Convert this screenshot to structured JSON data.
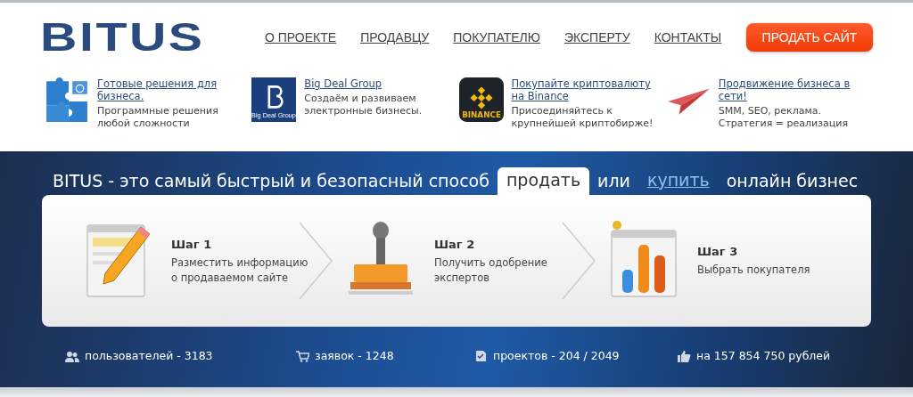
{
  "header": {
    "logo": "BITUS",
    "nav": [
      "О ПРОЕКТЕ",
      "ПРОДАВЦУ",
      "ПОКУПАТЕЛЮ",
      "ЭКСПЕРТУ",
      "КОНТАКТЫ"
    ],
    "cta": "ПРОДАТЬ САЙТ"
  },
  "promos": [
    {
      "kind": "puzzle",
      "title": "Готовые решения для бизнеса.",
      "text": "Программные решения любой сложности"
    },
    {
      "kind": "bigdeal",
      "logo_text": "Big Deal Group",
      "title": "Big Deal Group",
      "text": "Создаём и развиваем электронные бизнесы."
    },
    {
      "kind": "binance",
      "logo_text": "BINANCE",
      "title": "Покупайте криптовалюту на Binance",
      "text": "Присоединяйтесь к крупнейшей криптобирже!"
    },
    {
      "kind": "plane",
      "title": "Продвижение бизнеса в сети!",
      "text": "SMM, SEO, реклама. Стратегия = реализация"
    }
  ],
  "headline": {
    "prefix": "BITUS - это самый быстрый и безопасный способ",
    "options": [
      {
        "label": "продать",
        "selected": true
      },
      {
        "label": "купить",
        "selected": false
      }
    ],
    "separator": "или",
    "suffix": "онлайн бизнес"
  },
  "steps": [
    {
      "kind": "pencil",
      "title": "Шаг 1",
      "text": "Разместить информацию о продаваемом сайте"
    },
    {
      "kind": "stamp",
      "title": "Шаг 2",
      "text": "Получить одобрение экспертов"
    },
    {
      "kind": "chart",
      "title": "Шаг 3",
      "text": "Выбрать покупателя"
    }
  ],
  "stats": [
    {
      "kind": "users",
      "text": "пользователей - 3183"
    },
    {
      "kind": "cart",
      "text": "заявок - 1248"
    },
    {
      "kind": "doc",
      "text": "проектов - 204 / 2049"
    },
    {
      "kind": "like",
      "text": "на 157 854 750 рублей"
    }
  ]
}
